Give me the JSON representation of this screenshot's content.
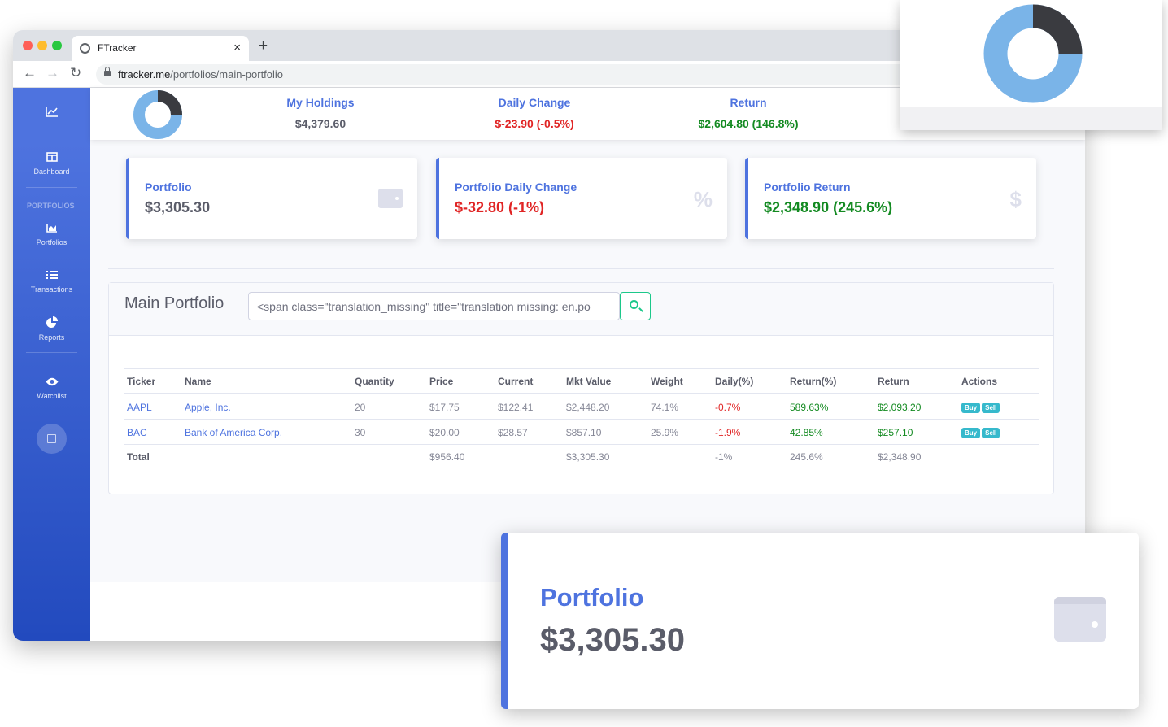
{
  "browser": {
    "tab_title": "FTracker",
    "tab_close": "×",
    "new_tab": "+",
    "url_host": "ftracker.me",
    "url_path": "/portfolios/main-portfolio"
  },
  "sidebar": {
    "brand_icon": "chart-line-icon",
    "items": [
      {
        "label": "Dashboard",
        "icon": "table-columns-icon"
      },
      {
        "label": "Portfolios",
        "icon": "chart-area-icon"
      },
      {
        "label": "Transactions",
        "icon": "list-icon"
      },
      {
        "label": "Reports",
        "icon": "chart-pie-icon"
      },
      {
        "label": "Watchlist",
        "icon": "eye-icon"
      }
    ],
    "heading": "PORTFOLIOS"
  },
  "topbar": {
    "holdings_label": "My Holdings",
    "holdings_value": "$4,379.60",
    "daily_label": "Daily Change",
    "daily_value": "$-23.90 (-0.5%)",
    "return_label": "Return",
    "return_value": "$2,604.80 (146.8%)",
    "donut_fractions": {
      "dark": 0.25,
      "light": 0.75
    }
  },
  "cards": [
    {
      "label": "Portfolio",
      "value": "$3,305.30",
      "icon": "wallet-icon"
    },
    {
      "label": "Portfolio Daily Change",
      "value": "$-32.80 (-1%)",
      "icon": "percent-icon",
      "icon_glyph": "%"
    },
    {
      "label": "Portfolio Return",
      "value": "$2,348.90 (245.6%)",
      "icon": "dollar-icon",
      "icon_glyph": "$"
    }
  ],
  "panel": {
    "title": "Main Portfolio",
    "search_value": "<span class=\"translation_missing\" title=\"translation missing: en.po"
  },
  "table": {
    "headers": [
      "Ticker",
      "Name",
      "Quantity",
      "Price",
      "Current",
      "Mkt Value",
      "Weight",
      "Daily(%)",
      "Return(%)",
      "Return",
      "Actions"
    ],
    "rows": [
      {
        "ticker": "AAPL",
        "name": "Apple, Inc.",
        "quantity": "20",
        "price": "$17.75",
        "current": "$122.41",
        "mkt_value": "$2,448.20",
        "weight": "74.1%",
        "daily": "-0.7%",
        "return_pct": "589.63%",
        "return": "$2,093.20",
        "buy": "Buy",
        "sell": "Sell"
      },
      {
        "ticker": "BAC",
        "name": "Bank of America Corp.",
        "quantity": "30",
        "price": "$20.00",
        "current": "$28.57",
        "mkt_value": "$857.10",
        "weight": "25.9%",
        "daily": "-1.9%",
        "return_pct": "42.85%",
        "return": "$257.10",
        "buy": "Buy",
        "sell": "Sell"
      }
    ],
    "total": {
      "label": "Total",
      "price": "$956.40",
      "mkt_value": "$3,305.30",
      "daily": "-1%",
      "return_pct": "245.6%",
      "return": "$2,348.90"
    }
  },
  "overlay": {
    "big_card_label": "Portfolio",
    "big_card_value": "$3,305.30"
  },
  "colors": {
    "primary": "#4e73df",
    "danger": "#e02424",
    "success": "#138a21",
    "donut_dark": "#3a3b40",
    "donut_light": "#7ab4e8"
  }
}
